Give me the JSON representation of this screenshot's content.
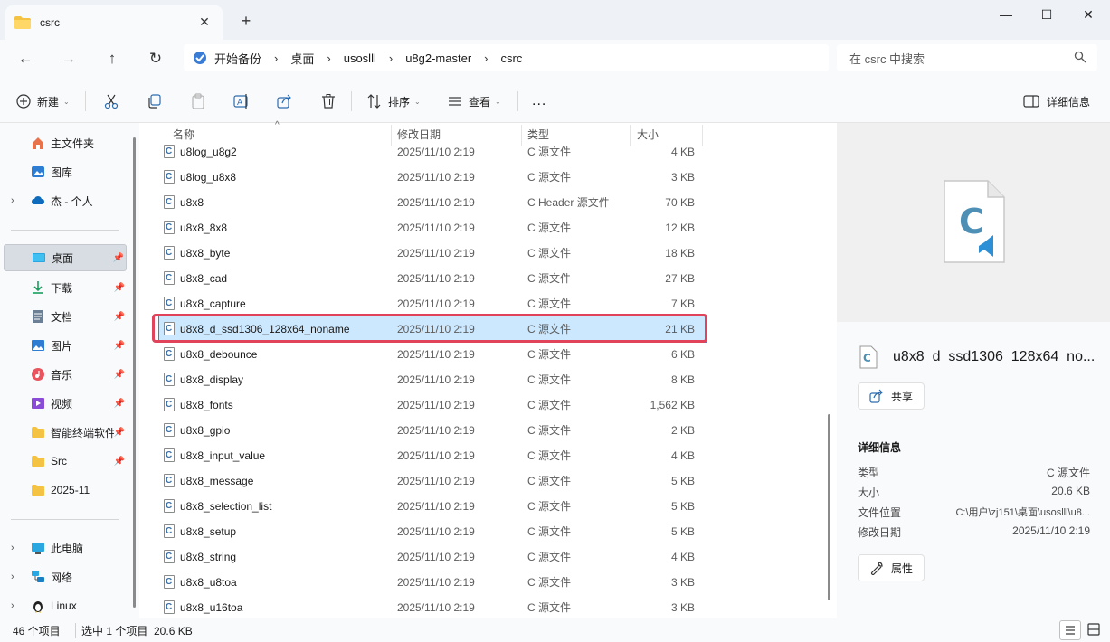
{
  "tab": {
    "title": "csrc"
  },
  "address": {
    "crumbs": [
      "开始备份",
      "桌面",
      "usoslll",
      "u8g2-master",
      "csrc"
    ]
  },
  "search": {
    "placeholder": "在 csrc 中搜索"
  },
  "toolbar": {
    "new_label": "新建",
    "sort_label": "排序",
    "view_label": "查看",
    "more_label": "...",
    "details_label": "详细信息"
  },
  "sidebar": {
    "items": [
      {
        "label": "主文件夹"
      },
      {
        "label": "图库"
      },
      {
        "label": "杰 - 个人"
      },
      {
        "label": "桌面"
      },
      {
        "label": "下载"
      },
      {
        "label": "文档"
      },
      {
        "label": "图片"
      },
      {
        "label": "音乐"
      },
      {
        "label": "视频"
      },
      {
        "label": "智能终端软件"
      },
      {
        "label": "Src"
      },
      {
        "label": "2025-11"
      },
      {
        "label": "此电脑"
      },
      {
        "label": "网络"
      },
      {
        "label": "Linux"
      }
    ]
  },
  "columns": {
    "name": "名称",
    "date": "修改日期",
    "type": "类型",
    "size": "大小"
  },
  "files": [
    {
      "name": "u8log_u8g2",
      "date": "2025/11/10 2:19",
      "type": "C 源文件",
      "size": "4 KB"
    },
    {
      "name": "u8log_u8x8",
      "date": "2025/11/10 2:19",
      "type": "C 源文件",
      "size": "3 KB"
    },
    {
      "name": "u8x8",
      "date": "2025/11/10 2:19",
      "type": "C Header 源文件",
      "size": "70 KB"
    },
    {
      "name": "u8x8_8x8",
      "date": "2025/11/10 2:19",
      "type": "C 源文件",
      "size": "12 KB"
    },
    {
      "name": "u8x8_byte",
      "date": "2025/11/10 2:19",
      "type": "C 源文件",
      "size": "18 KB"
    },
    {
      "name": "u8x8_cad",
      "date": "2025/11/10 2:19",
      "type": "C 源文件",
      "size": "27 KB"
    },
    {
      "name": "u8x8_capture",
      "date": "2025/11/10 2:19",
      "type": "C 源文件",
      "size": "7 KB"
    },
    {
      "name": "u8x8_d_ssd1306_128x64_noname",
      "date": "2025/11/10 2:19",
      "type": "C 源文件",
      "size": "21 KB"
    },
    {
      "name": "u8x8_debounce",
      "date": "2025/11/10 2:19",
      "type": "C 源文件",
      "size": "6 KB"
    },
    {
      "name": "u8x8_display",
      "date": "2025/11/10 2:19",
      "type": "C 源文件",
      "size": "8 KB"
    },
    {
      "name": "u8x8_fonts",
      "date": "2025/11/10 2:19",
      "type": "C 源文件",
      "size": "1,562 KB"
    },
    {
      "name": "u8x8_gpio",
      "date": "2025/11/10 2:19",
      "type": "C 源文件",
      "size": "2 KB"
    },
    {
      "name": "u8x8_input_value",
      "date": "2025/11/10 2:19",
      "type": "C 源文件",
      "size": "4 KB"
    },
    {
      "name": "u8x8_message",
      "date": "2025/11/10 2:19",
      "type": "C 源文件",
      "size": "5 KB"
    },
    {
      "name": "u8x8_selection_list",
      "date": "2025/11/10 2:19",
      "type": "C 源文件",
      "size": "5 KB"
    },
    {
      "name": "u8x8_setup",
      "date": "2025/11/10 2:19",
      "type": "C 源文件",
      "size": "5 KB"
    },
    {
      "name": "u8x8_string",
      "date": "2025/11/10 2:19",
      "type": "C 源文件",
      "size": "4 KB"
    },
    {
      "name": "u8x8_u8toa",
      "date": "2025/11/10 2:19",
      "type": "C 源文件",
      "size": "3 KB"
    },
    {
      "name": "u8x8_u16toa",
      "date": "2025/11/10 2:19",
      "type": "C 源文件",
      "size": "3 KB"
    }
  ],
  "details": {
    "name": "u8x8_d_ssd1306_128x64_no...",
    "share_label": "共享",
    "section_title": "详细信息",
    "props": [
      {
        "label": "类型",
        "value": "C 源文件"
      },
      {
        "label": "大小",
        "value": "20.6 KB"
      },
      {
        "label": "文件位置",
        "value": "C:\\用户\\zj151\\桌面\\usoslll\\u8..."
      },
      {
        "label": "修改日期",
        "value": "2025/11/10 2:19"
      }
    ],
    "properties_label": "属性"
  },
  "status": {
    "count": "46 个项目",
    "selected": "选中 1 个项目  20.6 KB"
  },
  "colors": {
    "accent": "#0067c0",
    "selection": "#cce8ff",
    "highlight_box": "#e0435a"
  }
}
